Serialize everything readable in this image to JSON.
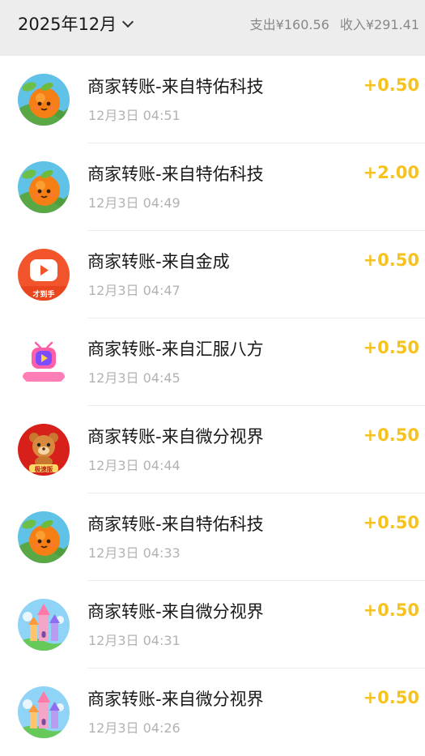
{
  "header": {
    "month": "2025年12月",
    "expense_label": "支出¥160.56",
    "income_label": "收入¥291.41"
  },
  "transactions": [
    {
      "title": "商家转账-来自特佑科技",
      "time": "12月3日 04:51",
      "amount": "+0.50",
      "icon": "orange-fruit-icon"
    },
    {
      "title": "商家转账-来自特佑科技",
      "time": "12月3日 04:49",
      "amount": "+2.00",
      "icon": "orange-fruit-icon"
    },
    {
      "title": "商家转账-来自金成",
      "time": "12月3日 04:47",
      "amount": "+0.50",
      "icon": "video-play-icon",
      "badge": "才到手"
    },
    {
      "title": "商家转账-来自汇服八方",
      "time": "12月3日 04:45",
      "amount": "+0.50",
      "icon": "tv-play-icon"
    },
    {
      "title": "商家转账-来自微分视界",
      "time": "12月3日 04:44",
      "amount": "+0.50",
      "icon": "bear-mascot-icon",
      "badge": "极速版"
    },
    {
      "title": "商家转账-来自特佑科技",
      "time": "12月3日 04:33",
      "amount": "+0.50",
      "icon": "orange-fruit-icon"
    },
    {
      "title": "商家转账-来自微分视界",
      "time": "12月3日 04:31",
      "amount": "+0.50",
      "icon": "castle-icon"
    },
    {
      "title": "商家转账-来自微分视界",
      "time": "12月3日 04:26",
      "amount": "+0.50",
      "icon": "castle-icon"
    }
  ],
  "colors": {
    "amount": "#f8c21c",
    "header_bg": "#ededed",
    "title_text": "#191919",
    "time_text": "#b2b2b2"
  }
}
